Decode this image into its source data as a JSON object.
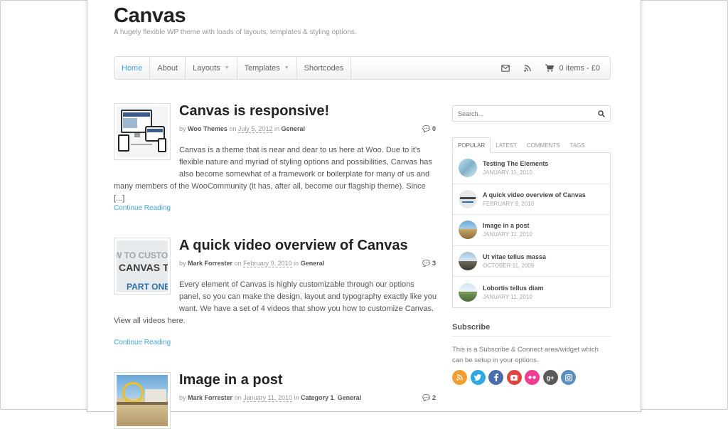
{
  "site": {
    "title": "Canvas",
    "description": "A hugely flexible WP theme with loads of layouts, templates & styling options."
  },
  "nav": {
    "items": [
      {
        "label": "Home",
        "active": true
      },
      {
        "label": "About"
      },
      {
        "label": "Layouts",
        "dropdown": true
      },
      {
        "label": "Templates",
        "dropdown": true
      },
      {
        "label": "Shortcodes"
      }
    ],
    "email_icon": "envelope-icon",
    "rss_icon": "rss-icon",
    "cart_label": "0 items - £0"
  },
  "posts": [
    {
      "title": "Canvas is responsive!",
      "by": "by",
      "author": "Woo Themes",
      "on": "on",
      "date": "July 5, 2012",
      "in": "in",
      "category": "General",
      "comments": "0",
      "excerpt": "Canvas is a theme that is near and dear to us here at Woo. Due to it’s flexible nature and myriad of styling options and possibilities, Canvas has also become somewhat of a framework or boilerplate for many of us and many members of the WooCommunity (it has, after all, become our flagship theme). Since [...]",
      "continue": "Continue Reading"
    },
    {
      "title": "A quick video overview of Canvas",
      "by": "by",
      "author": "Mark Forrester",
      "on": "on",
      "date": "February 9, 2010",
      "in": "in",
      "category": "General",
      "comments": "3",
      "excerpt": "Every element of Canvas is highly customizable through our options panel, so you can make the design, layout and typography exactly like you want. We have a set of 4 videos that show you how to customize Canvas. View all videos here.",
      "continue": "Continue Reading",
      "thumb_text": [
        "W TO CUSTOMIZ",
        "CANVAS THE",
        "PART ONE"
      ]
    },
    {
      "title": "Image in a post",
      "by": "by",
      "author": "Mark Forrester",
      "on": "on",
      "date": "January 11, 2010",
      "in": "in",
      "category": "Category 1",
      "category2": "General",
      "comments": "2"
    }
  ],
  "sidebar": {
    "search_placeholder": "Search...",
    "tabs": [
      "POPULAR",
      "LATEST",
      "COMMENTS",
      "TAGS"
    ],
    "popular": [
      {
        "title": "Testing The Elements",
        "date": "JANUARY 11, 2010"
      },
      {
        "title": "A quick video overview of Canvas",
        "date": "FEBRUARY 9, 2010"
      },
      {
        "title": "Image in a post",
        "date": "JANUARY 11, 2010"
      },
      {
        "title": "Ut vitae tellus massa",
        "date": "OCTOBER 11, 2009"
      },
      {
        "title": "Lobortis tellus diam",
        "date": "JANUARY 11, 2010"
      }
    ],
    "subscribe_heading": "Subscribe",
    "subscribe_text": "This is a Subscribe & Connect area/widget which can be setup in your options.",
    "social": [
      {
        "name": "rss-icon",
        "color": "#f39c32"
      },
      {
        "name": "twitter-icon",
        "color": "#2ea7e0"
      },
      {
        "name": "facebook-icon",
        "color": "#4a6ea9"
      },
      {
        "name": "youtube-icon",
        "color": "#e0443f"
      },
      {
        "name": "flickr-icon",
        "color": "#f03d93"
      },
      {
        "name": "google-plus-icon",
        "color": "#5a5a5a"
      },
      {
        "name": "instagram-icon",
        "color": "#5b8fc2"
      }
    ]
  },
  "colors": {
    "accent": "#3fa6e0",
    "title": "#222222"
  }
}
